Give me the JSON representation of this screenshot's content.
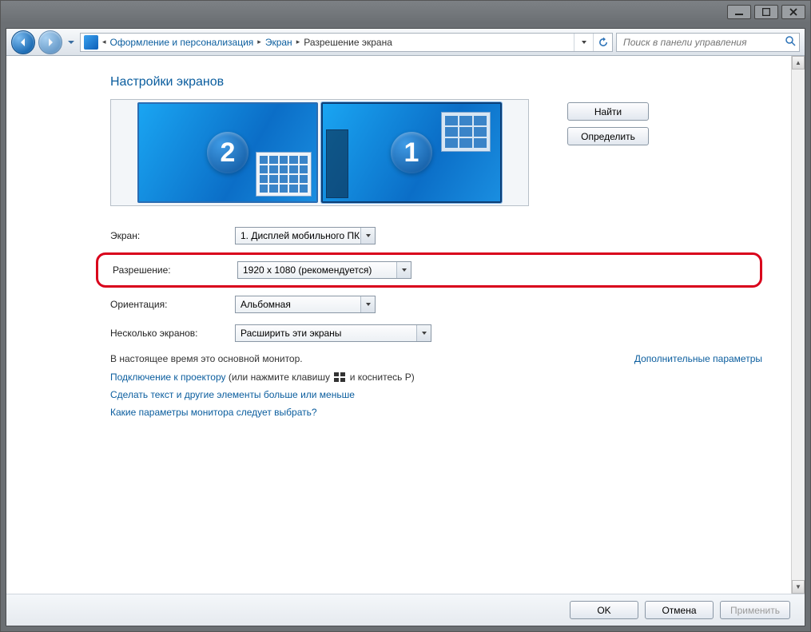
{
  "titlebar": {
    "min_label": "minimize",
    "max_label": "maximize",
    "close_label": "close"
  },
  "nav": {
    "breadcrumb": {
      "root": "Оформление и персонализация",
      "level2": "Экран",
      "current": "Разрешение экрана"
    },
    "search_placeholder": "Поиск в панели управления"
  },
  "page": {
    "heading": "Настройки экранов",
    "buttons": {
      "find": "Найти",
      "identify": "Определить"
    },
    "monitors": [
      {
        "number": "2",
        "selected": false
      },
      {
        "number": "1",
        "selected": true
      }
    ]
  },
  "form": {
    "screen": {
      "label": "Экран:",
      "value": "1. Дисплей мобильного ПК"
    },
    "resolution": {
      "label": "Разрешение:",
      "value": "1920 x 1080 (рекомендуется)"
    },
    "orientation": {
      "label": "Ориентация:",
      "value": "Альбомная"
    },
    "multi": {
      "label": "Несколько экранов:",
      "value": "Расширить эти экраны"
    }
  },
  "status": {
    "primary_monitor": "В настоящее время это основной монитор.",
    "advanced_link": "Дополнительные параметры"
  },
  "links": {
    "projector_link": "Подключение к проектору",
    "projector_suffix1": " (или нажмите клавишу ",
    "projector_suffix2": " и коснитесь P)",
    "text_size": "Сделать текст и другие элементы больше или меньше",
    "which_settings": "Какие параметры монитора следует выбрать?"
  },
  "footer": {
    "ok": "OK",
    "cancel": "Отмена",
    "apply": "Применить"
  }
}
